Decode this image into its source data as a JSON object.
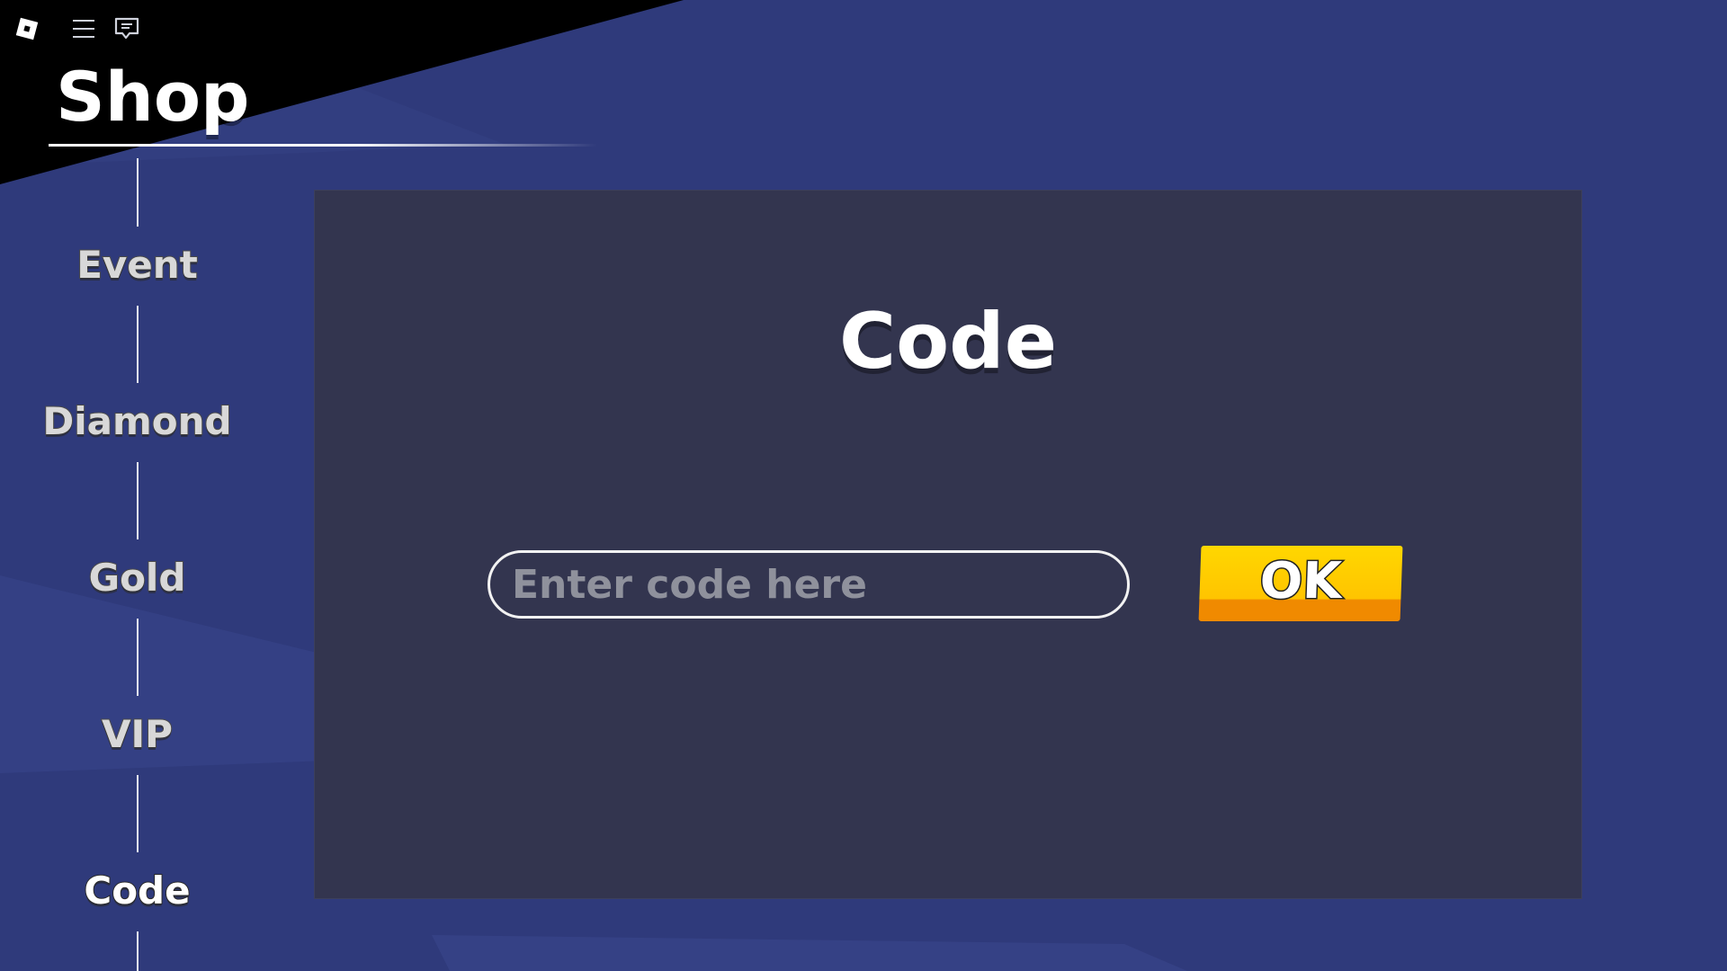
{
  "topbar": {
    "icons": [
      "roblox-logo-icon",
      "menu-icon",
      "chat-icon"
    ]
  },
  "shop": {
    "title": "Shop"
  },
  "nav": {
    "items": [
      {
        "label": "Event",
        "active": false
      },
      {
        "label": "Diamond",
        "active": false
      },
      {
        "label": "Gold",
        "active": false
      },
      {
        "label": "VIP",
        "active": false
      },
      {
        "label": "Code",
        "active": true
      }
    ]
  },
  "panel": {
    "title": "Code",
    "input_value": "",
    "input_placeholder": "Enter code here",
    "ok_label": "OK"
  },
  "colors": {
    "background": "#2f3a7b",
    "panel": "#33354f",
    "ok_button": "#ffc400",
    "ok_button_shadow": "#f08a00"
  }
}
